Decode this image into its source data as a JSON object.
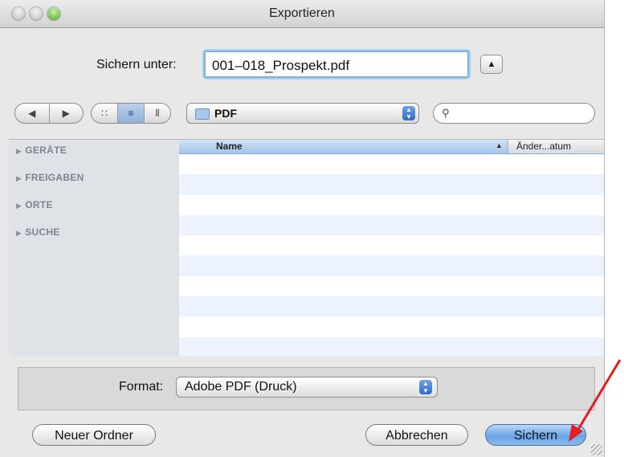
{
  "window": {
    "title": "Exportieren"
  },
  "saveas": {
    "label": "Sichern unter:",
    "value": "001–018_Prospekt.pdf",
    "disclosure_icon": "▲"
  },
  "toolbar": {
    "nav": {
      "back_icon": "◀",
      "forward_icon": "▶"
    },
    "views": {
      "icon_view": "∷",
      "list_view": "≡",
      "column_view": "⫴"
    },
    "location": "PDF",
    "search_placeholder": ""
  },
  "sidebar": {
    "items": [
      {
        "label": "GERÄTE"
      },
      {
        "label": "FREIGABEN"
      },
      {
        "label": "ORTE"
      },
      {
        "label": "SUCHE"
      }
    ]
  },
  "filelist": {
    "columns": {
      "name": "Name",
      "date": "Änder...atum"
    },
    "sort_icon": "▲"
  },
  "format": {
    "label": "Format:",
    "selected": "Adobe PDF (Druck)"
  },
  "buttons": {
    "new_folder": "Neuer Ordner",
    "cancel": "Abbrechen",
    "save": "Sichern"
  },
  "colors": {
    "accent": "#6aa5e6",
    "arrow": "#e02020",
    "row_alt": "#edf3fe"
  }
}
